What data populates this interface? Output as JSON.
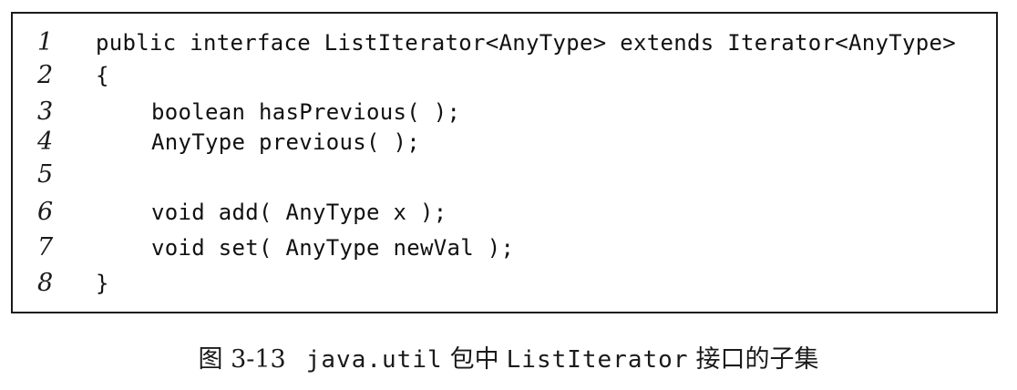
{
  "code": {
    "lines": [
      {
        "number": "1",
        "text": "public interface ListIterator<AnyType> extends Iterator<AnyType>"
      },
      {
        "number": "2",
        "text": "{"
      },
      {
        "number": "3",
        "text": "boolean hasPrevious( );"
      },
      {
        "number": "4",
        "text": "AnyType previous( );"
      },
      {
        "number": "5",
        "text": ""
      },
      {
        "number": "6",
        "text": "void add( AnyType x );"
      },
      {
        "number": "7",
        "text": "void set( AnyType newVal );"
      },
      {
        "number": "8",
        "text": "}"
      }
    ]
  },
  "caption": {
    "figure_label": "图 3-13",
    "package": "java.util",
    "text_in": "包中",
    "interface_name": "ListIterator",
    "text_subset": "接口的子集"
  }
}
